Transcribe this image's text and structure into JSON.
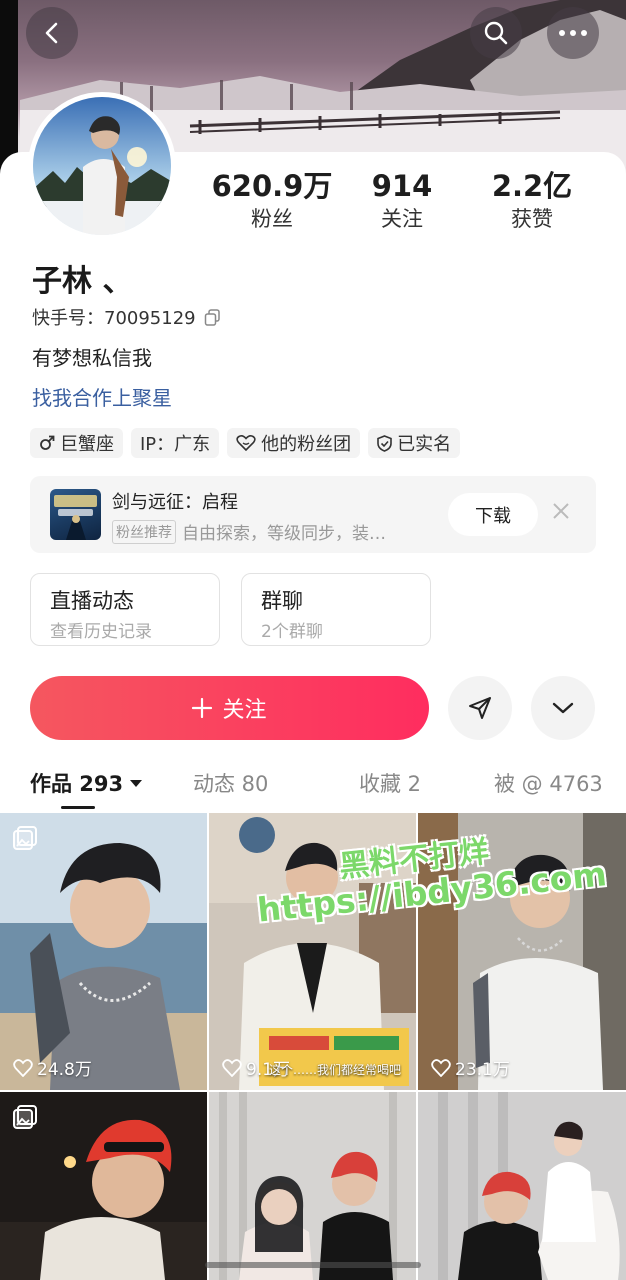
{
  "header": {
    "back_icon": "back-arrow-icon",
    "search_icon": "search-icon",
    "more_icon": "more-dots-icon"
  },
  "stats": {
    "fans": {
      "value": "620.9万",
      "label": "粉丝"
    },
    "following": {
      "value": "914",
      "label": "关注"
    },
    "likes": {
      "value": "2.2亿",
      "label": "获赞"
    }
  },
  "profile": {
    "name": "子林 、",
    "kuaishou_id": "快手号：70095129",
    "bio": "有梦想私信我",
    "link": "找我合作上聚星"
  },
  "tags": [
    {
      "icon": "male-icon",
      "text": "巨蟹座"
    },
    {
      "icon": "",
      "text": "IP：广东"
    },
    {
      "icon": "heart-icon",
      "text": "他的粉丝团"
    },
    {
      "icon": "verified-shield-icon",
      "text": "已实名"
    }
  ],
  "promo": {
    "title": "剑与远征：启程",
    "badge": "粉丝推荐",
    "desc": "自由探索，等级同步，装…",
    "download": "下载"
  },
  "boxes": [
    {
      "title": "直播动态",
      "sub": "查看历史记录"
    },
    {
      "title": "群聊",
      "sub": "2个群聊"
    }
  ],
  "actions": {
    "follow": "关注"
  },
  "tabs": [
    {
      "label": "作品 293"
    },
    {
      "label": "动态 80"
    },
    {
      "label": "收藏 2"
    },
    {
      "label": "被 @ 4763"
    }
  ],
  "videos": [
    {
      "likes": "24.8万"
    },
    {
      "likes": "9.1万",
      "caption": "这个……我们都经常喝吧"
    },
    {
      "likes": "23.1万"
    }
  ],
  "watermark": {
    "line1": "黑料不打烊",
    "line2": "https://ibdy36.com"
  },
  "colors": {
    "accent": "#ff2d5f",
    "link": "#3a5fa0",
    "watermark": "#7cd86a"
  }
}
